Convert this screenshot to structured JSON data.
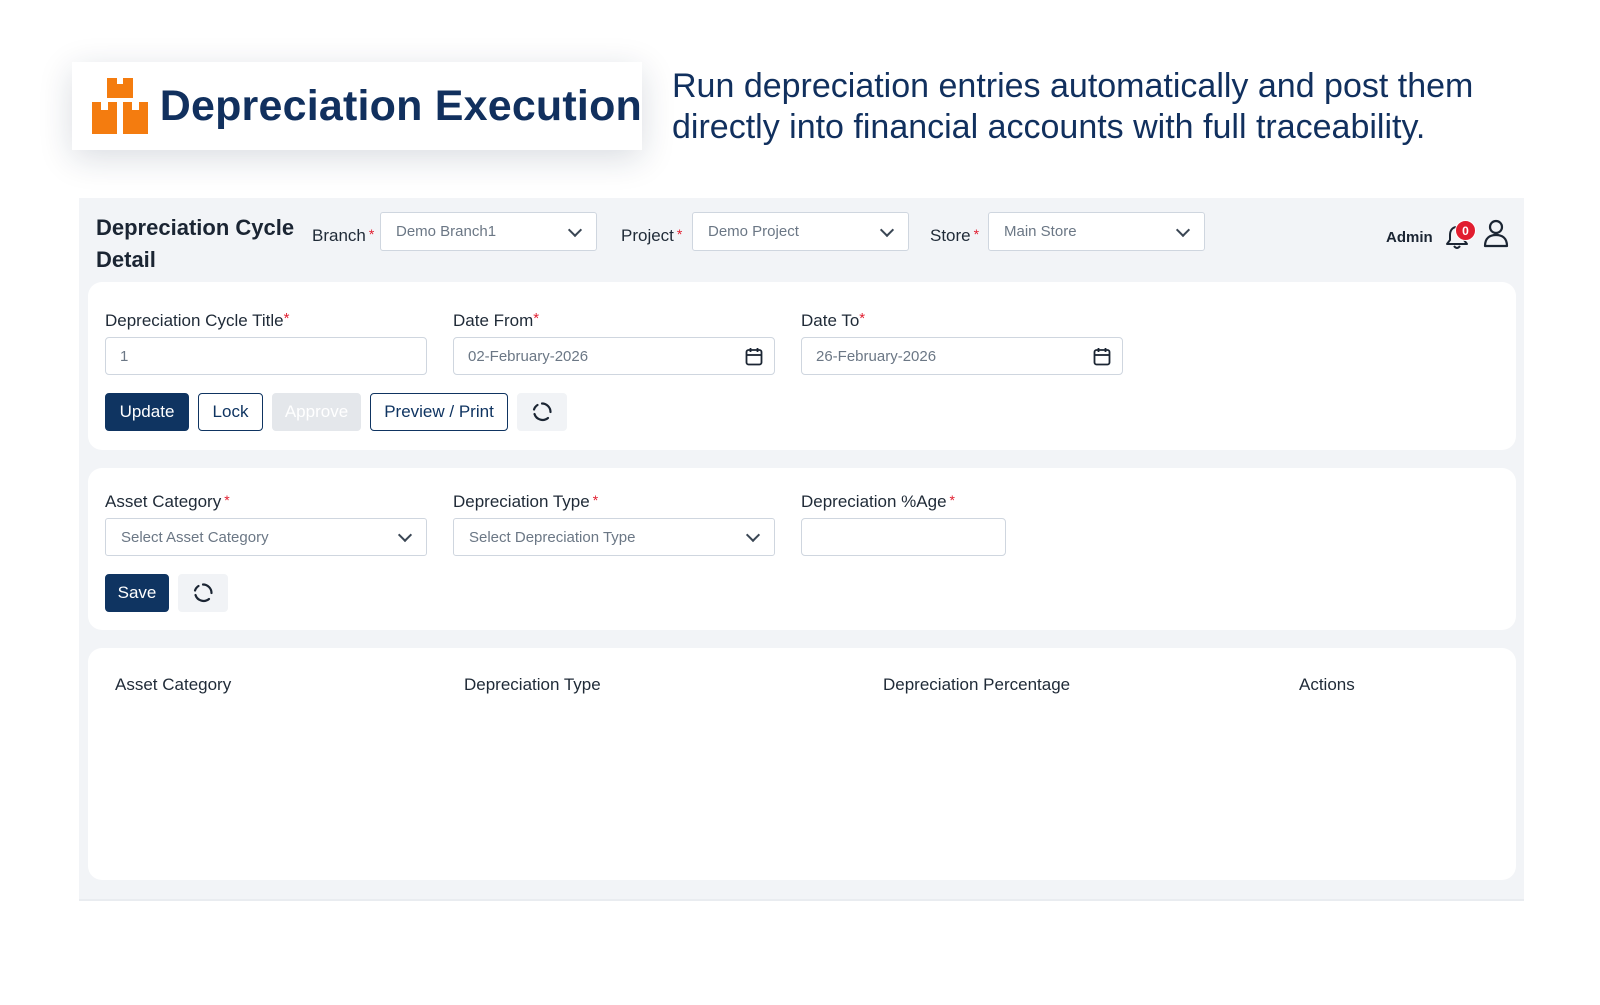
{
  "hero": {
    "title": "Depreciation Execution",
    "tagline_line1": "Run depreciation entries automatically and post them",
    "tagline_line2": "directly into financial accounts with full traceability.",
    "logo_color": "#f47c0f",
    "title_color": "#11305e"
  },
  "header": {
    "page_title_line1": "Depreciation Cycle",
    "page_title_line2": "Detail",
    "branch": {
      "label": "Branch",
      "required": "*",
      "value": "Demo Branch1"
    },
    "project": {
      "label": "Project",
      "required": "*",
      "value": "Demo Project"
    },
    "store": {
      "label": "Store",
      "required": "*",
      "value": "Main Store"
    },
    "user": "Admin",
    "notification_count": "0"
  },
  "cycle_form": {
    "title_label": "Depreciation Cycle Title",
    "title_value": "1",
    "date_from_label": "Date From",
    "date_from_value": "02-February-2026",
    "date_to_label": "Date To",
    "date_to_value": "26-February-2026",
    "required": "*",
    "buttons": {
      "update": "Update",
      "lock": "Lock",
      "approve": "Approve",
      "preview_print": "Preview / Print"
    }
  },
  "entry_form": {
    "asset_category_label": "Asset Category",
    "asset_category_placeholder": "Select Asset Category",
    "depreciation_type_label": "Depreciation Type",
    "depreciation_type_placeholder": "Select Depreciation Type",
    "percentage_label": "Depreciation %Age",
    "percentage_value": "",
    "required": "*",
    "save": "Save"
  },
  "table": {
    "columns": [
      "Asset Category",
      "Depreciation Type",
      "Depreciation Percentage",
      "Actions"
    ],
    "rows": []
  },
  "colors": {
    "primary": "#0f3461",
    "required": "#e11d2f",
    "app_background": "#f2f4f7"
  },
  "icons": [
    "boxes-logo-icon",
    "chevron-down-icon",
    "bell-icon",
    "user-icon",
    "calendar-icon",
    "refresh-icon"
  ]
}
